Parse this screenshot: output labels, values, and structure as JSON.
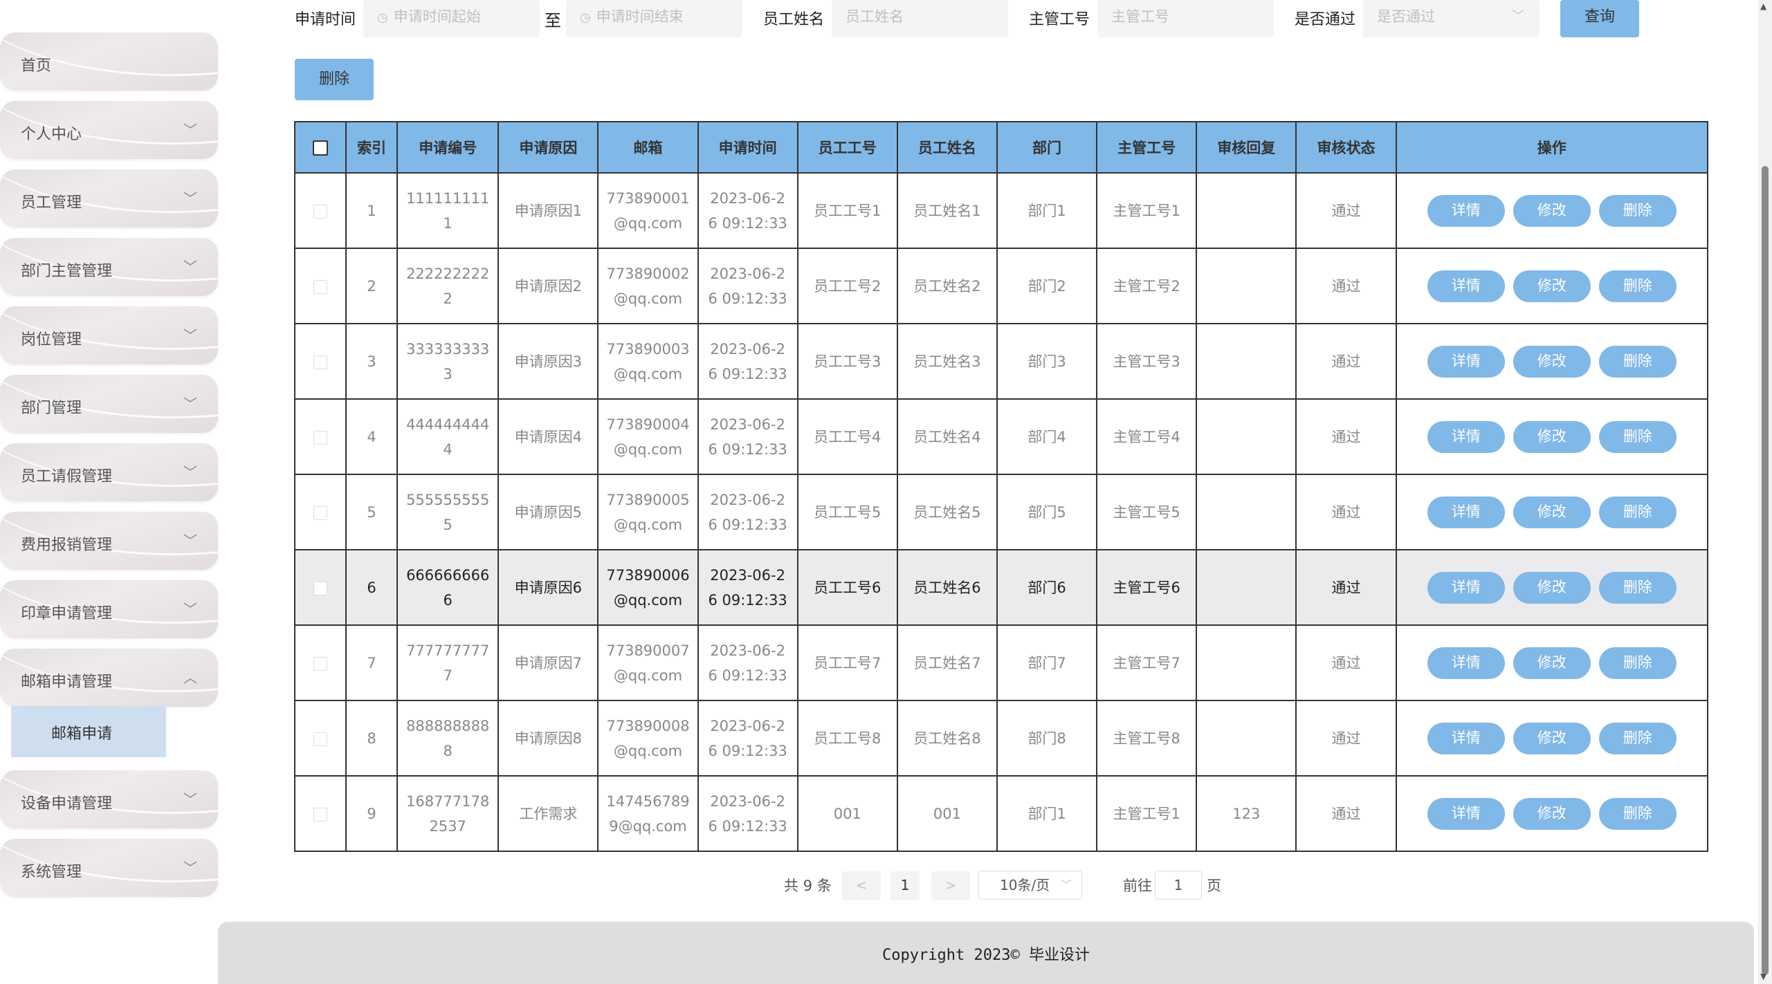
{
  "sidebar": {
    "items": [
      {
        "label": "首页",
        "chevron": ""
      },
      {
        "label": "个人中心",
        "chevron": "﹀"
      },
      {
        "label": "员工管理",
        "chevron": "﹀"
      },
      {
        "label": "部门主管管理",
        "chevron": "﹀"
      },
      {
        "label": "岗位管理",
        "chevron": "﹀"
      },
      {
        "label": "部门管理",
        "chevron": "﹀"
      },
      {
        "label": "员工请假管理",
        "chevron": "﹀"
      },
      {
        "label": "费用报销管理",
        "chevron": "﹀"
      },
      {
        "label": "印章申请管理",
        "chevron": "﹀"
      },
      {
        "label": "邮箱申请管理",
        "chevron": "︿"
      },
      {
        "label": "设备申请管理",
        "chevron": "﹀"
      },
      {
        "label": "系统管理",
        "chevron": "﹀"
      }
    ],
    "active_sub": "邮箱申请"
  },
  "filters": {
    "time_label": "申请时间",
    "time_start_placeholder": "申请时间起始",
    "to_label": "至",
    "time_end_placeholder": "申请时间结束",
    "name_label": "员工姓名",
    "name_placeholder": "员工姓名",
    "manager_label": "主管工号",
    "manager_placeholder": "主管工号",
    "pass_label": "是否通过",
    "pass_placeholder": "是否通过",
    "query_button": "查询",
    "delete_button": "删除"
  },
  "table": {
    "headers": [
      "索引",
      "申请编号",
      "申请原因",
      "邮箱",
      "申请时间",
      "员工工号",
      "员工姓名",
      "部门",
      "主管工号",
      "审核回复",
      "审核状态",
      "操作"
    ],
    "actions": {
      "detail": "详情",
      "edit": "修改",
      "delete": "删除"
    },
    "rows": [
      {
        "index": "1",
        "code1": "111111111",
        "code2": "1",
        "reason": "申请原因1",
        "mail1": "773890001",
        "mail2": "@qq.com",
        "time1": "2023-06-2",
        "time2": "6 09:12:33",
        "emp_no": "员工工号1",
        "emp_name": "员工姓名1",
        "dept": "部门1",
        "mgr": "主管工号1",
        "reply": "",
        "status": "通过"
      },
      {
        "index": "2",
        "code1": "222222222",
        "code2": "2",
        "reason": "申请原因2",
        "mail1": "773890002",
        "mail2": "@qq.com",
        "time1": "2023-06-2",
        "time2": "6 09:12:33",
        "emp_no": "员工工号2",
        "emp_name": "员工姓名2",
        "dept": "部门2",
        "mgr": "主管工号2",
        "reply": "",
        "status": "通过"
      },
      {
        "index": "3",
        "code1": "333333333",
        "code2": "3",
        "reason": "申请原因3",
        "mail1": "773890003",
        "mail2": "@qq.com",
        "time1": "2023-06-2",
        "time2": "6 09:12:33",
        "emp_no": "员工工号3",
        "emp_name": "员工姓名3",
        "dept": "部门3",
        "mgr": "主管工号3",
        "reply": "",
        "status": "通过"
      },
      {
        "index": "4",
        "code1": "444444444",
        "code2": "4",
        "reason": "申请原因4",
        "mail1": "773890004",
        "mail2": "@qq.com",
        "time1": "2023-06-2",
        "time2": "6 09:12:33",
        "emp_no": "员工工号4",
        "emp_name": "员工姓名4",
        "dept": "部门4",
        "mgr": "主管工号4",
        "reply": "",
        "status": "通过"
      },
      {
        "index": "5",
        "code1": "555555555",
        "code2": "5",
        "reason": "申请原因5",
        "mail1": "773890005",
        "mail2": "@qq.com",
        "time1": "2023-06-2",
        "time2": "6 09:12:33",
        "emp_no": "员工工号5",
        "emp_name": "员工姓名5",
        "dept": "部门5",
        "mgr": "主管工号5",
        "reply": "",
        "status": "通过"
      },
      {
        "index": "6",
        "code1": "666666666",
        "code2": "6",
        "reason": "申请原因6",
        "mail1": "773890006",
        "mail2": "@qq.com",
        "time1": "2023-06-2",
        "time2": "6 09:12:33",
        "emp_no": "员工工号6",
        "emp_name": "员工姓名6",
        "dept": "部门6",
        "mgr": "主管工号6",
        "reply": "",
        "status": "通过"
      },
      {
        "index": "7",
        "code1": "777777777",
        "code2": "7",
        "reason": "申请原因7",
        "mail1": "773890007",
        "mail2": "@qq.com",
        "time1": "2023-06-2",
        "time2": "6 09:12:33",
        "emp_no": "员工工号7",
        "emp_name": "员工姓名7",
        "dept": "部门7",
        "mgr": "主管工号7",
        "reply": "",
        "status": "通过"
      },
      {
        "index": "8",
        "code1": "888888888",
        "code2": "8",
        "reason": "申请原因8",
        "mail1": "773890008",
        "mail2": "@qq.com",
        "time1": "2023-06-2",
        "time2": "6 09:12:33",
        "emp_no": "员工工号8",
        "emp_name": "员工姓名8",
        "dept": "部门8",
        "mgr": "主管工号8",
        "reply": "",
        "status": "通过"
      },
      {
        "index": "9",
        "code1": "168777178",
        "code2": "2537",
        "reason": "工作需求",
        "mail1": "147456789",
        "mail2": "9@qq.com",
        "time1": "2023-06-2",
        "time2": "6 09:12:33",
        "emp_no": "001",
        "emp_name": "001",
        "dept": "部门1",
        "mgr": "主管工号1",
        "reply": "123",
        "status": "通过"
      }
    ]
  },
  "pagination": {
    "total": "共 9 条",
    "prev": "<",
    "current": "1",
    "next": ">",
    "page_size": "10条/页",
    "goto_label": "前往",
    "goto_value": "1",
    "page_unit": "页"
  },
  "footer": {
    "copyright": "Copyright 2023© 毕业设计"
  },
  "colors": {
    "accent": "#80b8e8",
    "submenu_active": "#cfdeee",
    "footer": "#dedede"
  }
}
